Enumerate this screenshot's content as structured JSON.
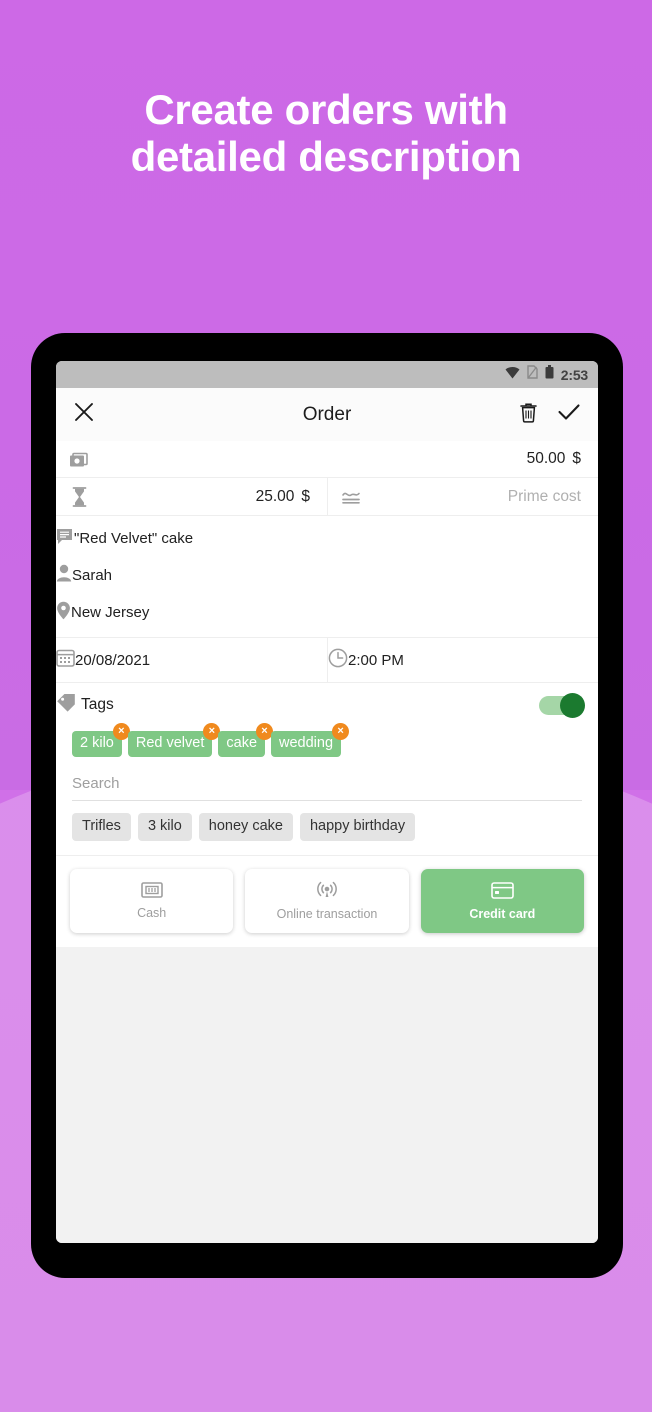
{
  "headline": {
    "line1": "Create orders with",
    "line2": "detailed description"
  },
  "colors": {
    "bg_top": "#cb6ae6",
    "bg_bottom": "#db8fec",
    "accent_green": "#7fc885",
    "switch_knob": "#1b7a2f",
    "chip_remove": "#f08a1e"
  },
  "statusbar": {
    "time": "2:53",
    "icons": [
      "wifi-icon",
      "sim-signal-icon",
      "battery-icon"
    ]
  },
  "appbar": {
    "close_icon": "close-icon",
    "title": "Order",
    "delete_icon": "trash-icon",
    "confirm_icon": "check-icon"
  },
  "form": {
    "price_row": {
      "icon": "money-icon",
      "value": "50.00",
      "currency": "$"
    },
    "cost_row": {
      "icon": "hourglass-icon",
      "value": "25.00",
      "currency": "$",
      "prime_icon": "trend-lines-icon",
      "prime_placeholder": "Prime cost"
    },
    "description": {
      "icon": "comment-icon",
      "value": "\"Red Velvet\" cake"
    },
    "customer": {
      "icon": "person-icon",
      "value": "Sarah"
    },
    "location": {
      "icon": "location-pin-icon",
      "value": "New Jersey"
    },
    "date": {
      "icon": "calendar-icon",
      "value": "20/08/2021"
    },
    "time": {
      "icon": "clock-icon",
      "value": "2:00 PM"
    }
  },
  "tags": {
    "icon": "tag-icon",
    "label": "Tags",
    "toggle_on": true,
    "selected": [
      {
        "label": "2 kilo",
        "remove": "×"
      },
      {
        "label": "Red velvet",
        "remove": "×"
      },
      {
        "label": "cake",
        "remove": "×"
      },
      {
        "label": "wedding",
        "remove": "×"
      }
    ],
    "search_placeholder": "Search",
    "search_value": "",
    "suggestions": [
      "Trifles",
      "3 kilo",
      "honey cake",
      "happy birthday"
    ]
  },
  "payments": [
    {
      "label": "Cash",
      "icon": "banknote-icon",
      "selected": false
    },
    {
      "label": "Online transaction",
      "icon": "contactless-icon",
      "selected": false
    },
    {
      "label": "Credit card",
      "icon": "credit-card-icon",
      "selected": true
    }
  ]
}
